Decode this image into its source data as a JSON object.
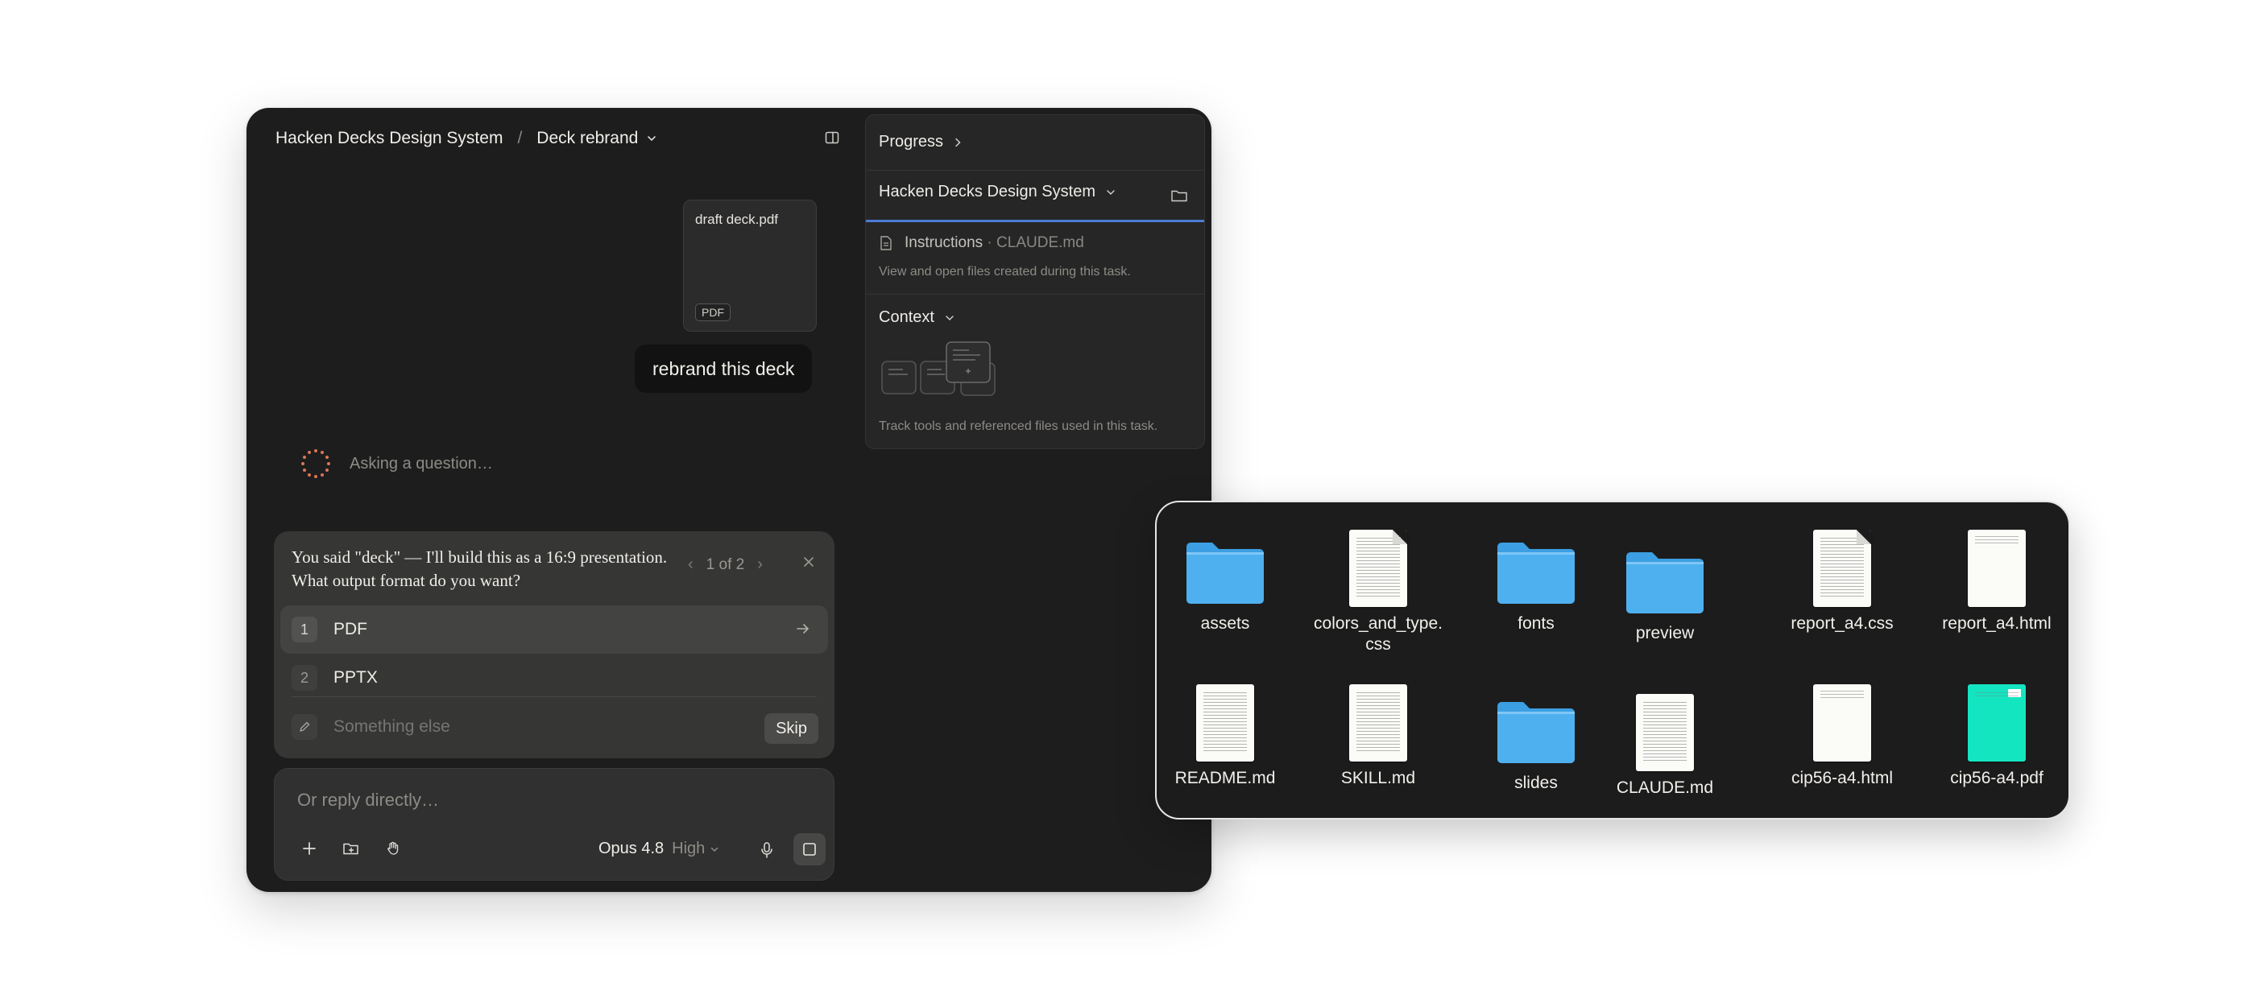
{
  "breadcrumb": {
    "project": "Hacken Decks Design System",
    "separator": "/",
    "task": "Deck rebrand"
  },
  "attachment": {
    "name": "draft deck.pdf",
    "type_tag": "PDF"
  },
  "user_message": "rebrand this deck",
  "status": {
    "text": "Asking a question…"
  },
  "question": {
    "text": "You said \"deck\" — I'll build this as a 16:9 presentation. What output format do you want?",
    "pager": "1 of 2",
    "options": [
      {
        "number": "1",
        "label": "PDF"
      },
      {
        "number": "2",
        "label": "PPTX"
      }
    ],
    "other_placeholder": "Something else",
    "skip_label": "Skip"
  },
  "composer": {
    "placeholder": "Or reply directly…",
    "model": "Opus 4.8",
    "effort": "High"
  },
  "side_panel": {
    "progress_label": "Progress",
    "project_label": "Hacken Decks Design System",
    "instructions_label": "Instructions",
    "instructions_file": "CLAUDE.md",
    "files_note": "View and open files created during this task.",
    "context_label": "Context",
    "context_note": "Track tools and referenced files used in this task."
  },
  "file_browser": {
    "items": [
      {
        "name": "assets",
        "kind": "folder"
      },
      {
        "name": "colors_and_type.\ncss",
        "kind": "doc"
      },
      {
        "name": "fonts",
        "kind": "folder"
      },
      {
        "name": "preview",
        "kind": "folder"
      },
      {
        "name": "report_a4.css",
        "kind": "doc"
      },
      {
        "name": "report_a4.html",
        "kind": "blank-doc"
      },
      {
        "name": "README.md",
        "kind": "doc"
      },
      {
        "name": "SKILL.md",
        "kind": "doc"
      },
      {
        "name": "slides",
        "kind": "folder"
      },
      {
        "name": "CLAUDE.md",
        "kind": "doc"
      },
      {
        "name": "cip56-a4.html",
        "kind": "blank-doc"
      },
      {
        "name": "cip56-a4.pdf",
        "kind": "pdf-teal"
      }
    ]
  },
  "colors": {
    "accent_spinner": "#d97757",
    "folder_blue": "#4fb0ef",
    "selection_line": "#4c7bd6",
    "pdf_teal": "#14e5c1"
  }
}
